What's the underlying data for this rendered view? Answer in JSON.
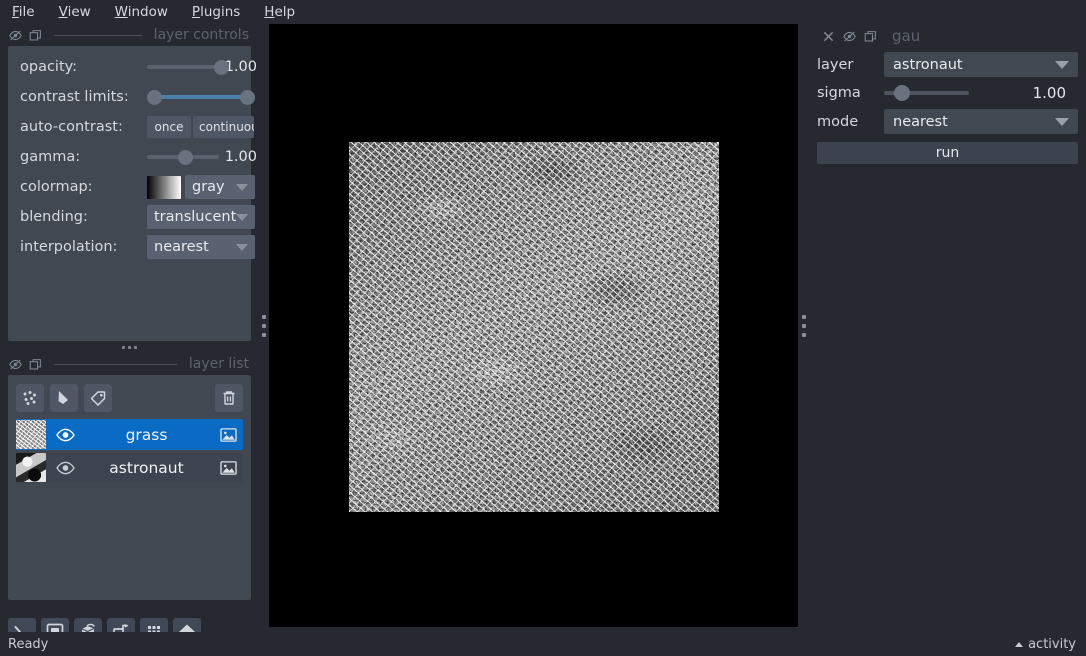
{
  "app": {
    "background": "#262930",
    "accent": "#0a6bc4",
    "panel": "#414852"
  },
  "menubar": {
    "items": [
      {
        "mnemonic": "F",
        "rest": "ile"
      },
      {
        "mnemonic": "V",
        "rest": "iew"
      },
      {
        "mnemonic": "W",
        "rest": "indow"
      },
      {
        "mnemonic": "P",
        "rest": "lugins"
      },
      {
        "mnemonic": "H",
        "rest": "elp"
      }
    ]
  },
  "layer_controls": {
    "title": "layer controls",
    "opacity": {
      "label": "opacity:",
      "value": "1.00",
      "percent": 100
    },
    "contrast_limits": {
      "label": "contrast limits:",
      "low_percent": 0,
      "high_percent": 100
    },
    "auto_contrast": {
      "label": "auto-contrast:",
      "once": "once",
      "continuous": "continuous"
    },
    "gamma": {
      "label": "gamma:",
      "value": "1.00",
      "percent": 45
    },
    "colormap": {
      "label": "colormap:",
      "value": "gray"
    },
    "blending": {
      "label": "blending:",
      "value": "translucent"
    },
    "interpolation": {
      "label": "interpolation:",
      "value": "nearest"
    }
  },
  "layer_list": {
    "title": "layer list",
    "buttons": [
      {
        "name": "new-points-layer",
        "tooltip": "New points layer"
      },
      {
        "name": "new-shapes-layer",
        "tooltip": "New shapes layer"
      },
      {
        "name": "new-labels-layer",
        "tooltip": "New labels layer"
      },
      {
        "name": "delete-layer",
        "tooltip": "Delete selected layers"
      }
    ],
    "layers": [
      {
        "name": "grass",
        "selected": true,
        "visible": true,
        "type": "image",
        "thumb": "grass"
      },
      {
        "name": "astronaut",
        "selected": false,
        "visible": true,
        "type": "image",
        "thumb": "astronaut"
      }
    ]
  },
  "viewer_buttons": [
    {
      "name": "console-button",
      "label": "Console"
    },
    {
      "name": "ndisplay-button",
      "label": "2D/3D toggle"
    },
    {
      "name": "roll-dims-button",
      "label": "Roll dimensions"
    },
    {
      "name": "transpose-dims-button",
      "label": "Transpose dimensions"
    },
    {
      "name": "grid-view-button",
      "label": "Grid view"
    },
    {
      "name": "home-button",
      "label": "Reset view"
    }
  ],
  "plugin_widget": {
    "title": "gau",
    "layer": {
      "label": "layer",
      "value": "astronaut"
    },
    "sigma": {
      "label": "sigma",
      "value": "1.00",
      "percent": 14
    },
    "mode": {
      "label": "mode",
      "value": "nearest"
    },
    "run": {
      "label": "run"
    }
  },
  "statusbar": {
    "status": "Ready",
    "activity": "activity"
  }
}
